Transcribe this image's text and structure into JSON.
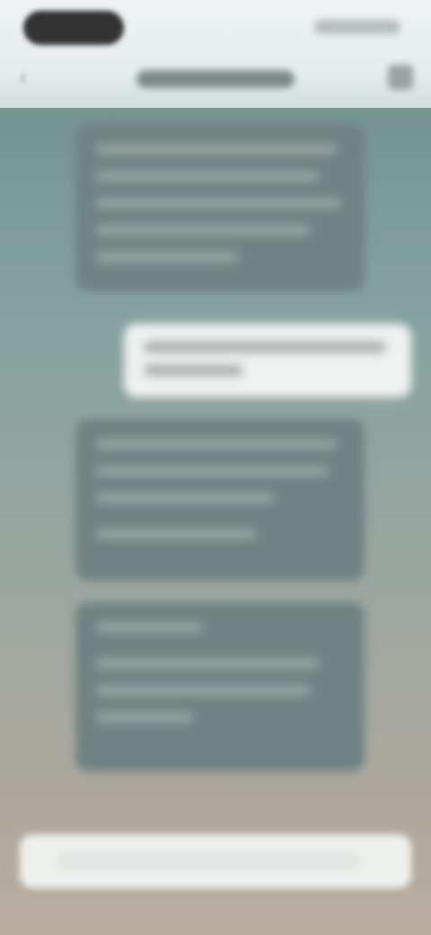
{
  "screen": {
    "description_visible": false
  },
  "header": {
    "title": "",
    "back_icon": "back-arrow-icon",
    "more_icon": "more-options-icon"
  },
  "messages": [
    {
      "role": "incoming",
      "text": ""
    },
    {
      "role": "outgoing",
      "text": ""
    },
    {
      "role": "incoming",
      "text": ""
    },
    {
      "role": "incoming",
      "text": ""
    }
  ],
  "composer": {
    "placeholder": ""
  },
  "colors": {
    "background_top": "#6d8c88",
    "background_bottom": "#b9ad9f",
    "incoming_bubble": "#6f8382",
    "outgoing_bubble": "#eef1ef",
    "header": "#eef2f2"
  }
}
